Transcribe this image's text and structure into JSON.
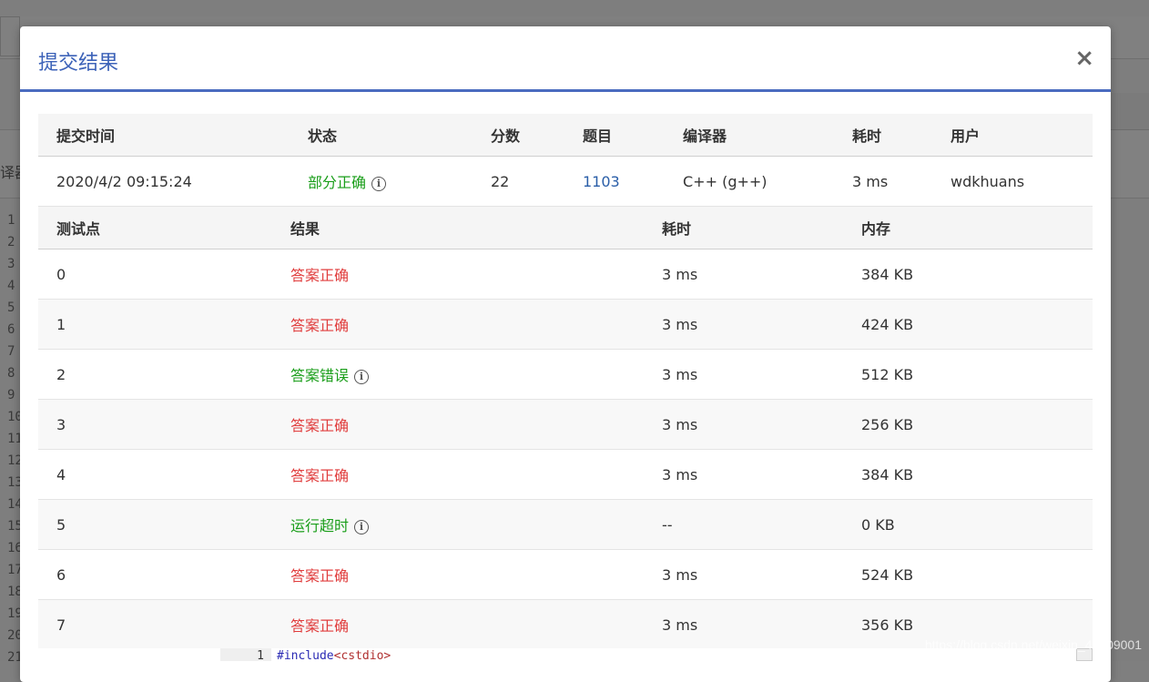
{
  "modal": {
    "title": "提交结果",
    "close_label": "×"
  },
  "summary": {
    "headers": [
      "提交时间",
      "状态",
      "分数",
      "题目",
      "编译器",
      "耗时",
      "用户"
    ],
    "row": {
      "time": "2020/4/2 09:15:24",
      "status": "部分正确",
      "score": "22",
      "problem": "1103",
      "compiler": "C++ (g++)",
      "duration": "3 ms",
      "user": "wdkhuans"
    }
  },
  "tests": {
    "headers": [
      "测试点",
      "结果",
      "耗时",
      "内存"
    ],
    "rows": [
      {
        "id": "0",
        "result": "答案正确",
        "time": "3 ms",
        "memory": "384 KB"
      },
      {
        "id": "1",
        "result": "答案正确",
        "time": "3 ms",
        "memory": "424 KB"
      },
      {
        "id": "2",
        "result": "答案错误",
        "time": "3 ms",
        "memory": "512 KB"
      },
      {
        "id": "3",
        "result": "答案正确",
        "time": "3 ms",
        "memory": "256 KB"
      },
      {
        "id": "4",
        "result": "答案正确",
        "time": "3 ms",
        "memory": "384 KB"
      },
      {
        "id": "5",
        "result": "运行超时",
        "time": "--",
        "memory": "0 KB"
      },
      {
        "id": "6",
        "result": "答案正确",
        "time": "3 ms",
        "memory": "524 KB"
      },
      {
        "id": "7",
        "result": "答案正确",
        "time": "3 ms",
        "memory": "356 KB"
      }
    ]
  },
  "background": {
    "left_label": "译器",
    "line_numbers": [
      "1",
      "2",
      "3",
      "4",
      "5",
      "6",
      "7",
      "8",
      "9",
      "10",
      "11",
      "12",
      "13",
      "14",
      "15",
      "16",
      "17",
      "18",
      "19",
      "20",
      "21"
    ]
  },
  "code": {
    "line_no": "1",
    "directive": "#include",
    "header": "<cstdio>"
  },
  "watermark": "https://blog.csdn.net/weixin_41809001",
  "colors": {
    "title": "#3c62b8",
    "header_border": "#4a6bbf",
    "correct": "#e03c3c",
    "wrong": "#1a9e1a",
    "link": "#2a5ea8"
  }
}
